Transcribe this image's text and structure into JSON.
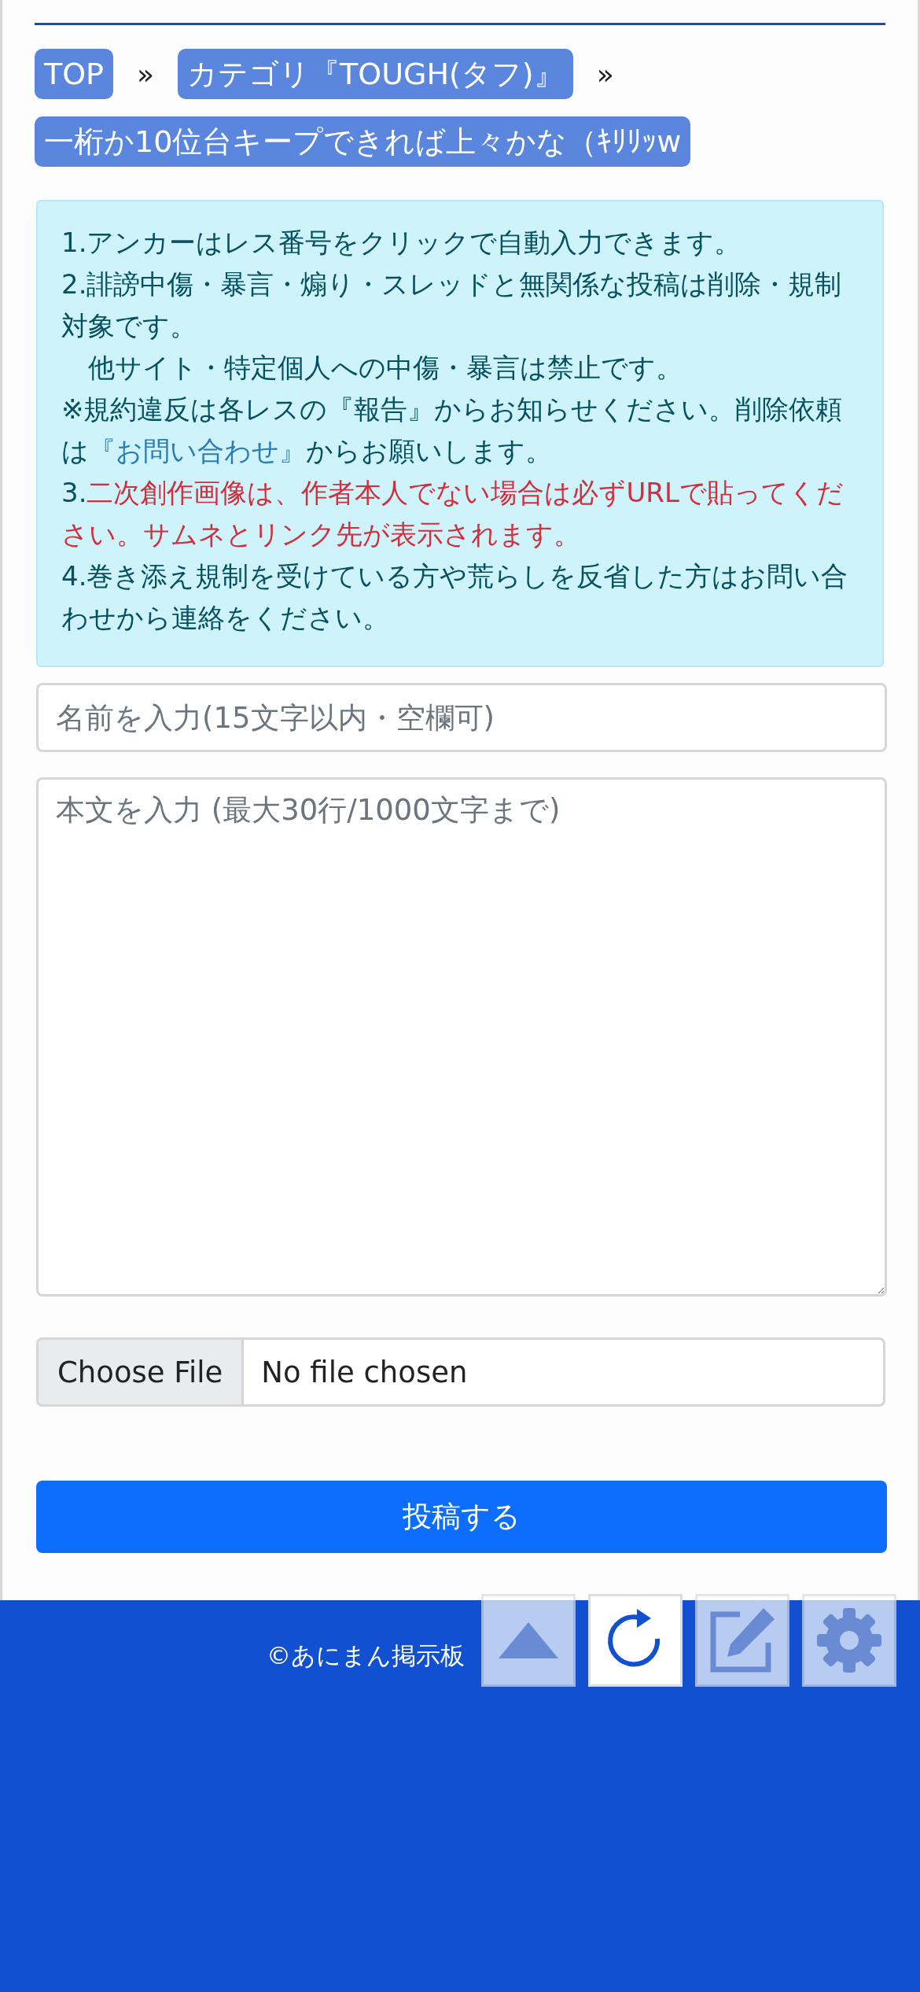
{
  "breadcrumbs": [
    {
      "label": "TOP"
    },
    {
      "label": "カテゴリ『TOUGH(タフ)』"
    },
    {
      "label": "一桁か10位台キープできれば上々かな（ｷﾘﾘｯw"
    }
  ],
  "separator": "»",
  "notice": [
    {
      "segments": [
        {
          "kind": "plain",
          "text": "1.アンカーはレス番号をクリックで自動入力できます。"
        }
      ]
    },
    {
      "segments": [
        {
          "kind": "plain",
          "text": "2.誹謗中傷・暴言・煽り・スレッドと無関係な投稿は削除・規制対象です。"
        }
      ]
    },
    {
      "segments": [
        {
          "kind": "plain",
          "text": "　他サイト・特定個人への中傷・暴言は禁止です。"
        }
      ]
    },
    {
      "segments": [
        {
          "kind": "plain",
          "text": "※規約違反は各レスの『報告』からお知らせください。削除依頼は"
        },
        {
          "kind": "link",
          "text": "『お問い合わせ』"
        },
        {
          "kind": "plain",
          "text": "からお願いします。"
        }
      ]
    },
    {
      "segments": [
        {
          "kind": "plain",
          "text": "3."
        },
        {
          "kind": "warning",
          "text": "二次創作画像は、作者本人でない場合は必ずURLで貼ってください。サムネとリンク先が表示されます。"
        }
      ]
    },
    {
      "segments": [
        {
          "kind": "plain",
          "text": "4.巻き添え規制を受けている方や荒らしを反省した方はお問い合わせから連絡をください。"
        }
      ]
    }
  ],
  "name_field": {
    "placeholder": "名前を入力(15文字以内・空欄可)"
  },
  "body_field": {
    "placeholder": "本文を入力 (最大30行/1000文字まで)"
  },
  "file_input": {
    "button": "Choose File",
    "status": "No file chosen"
  },
  "submit": {
    "label": "投稿する"
  },
  "footer": {
    "copyright": "©あにまん掲示板"
  },
  "floating_buttons": [
    {
      "kind": "up",
      "active": false
    },
    {
      "kind": "reload",
      "active": true
    },
    {
      "kind": "edit",
      "active": false
    },
    {
      "kind": "settings",
      "active": false
    }
  ]
}
